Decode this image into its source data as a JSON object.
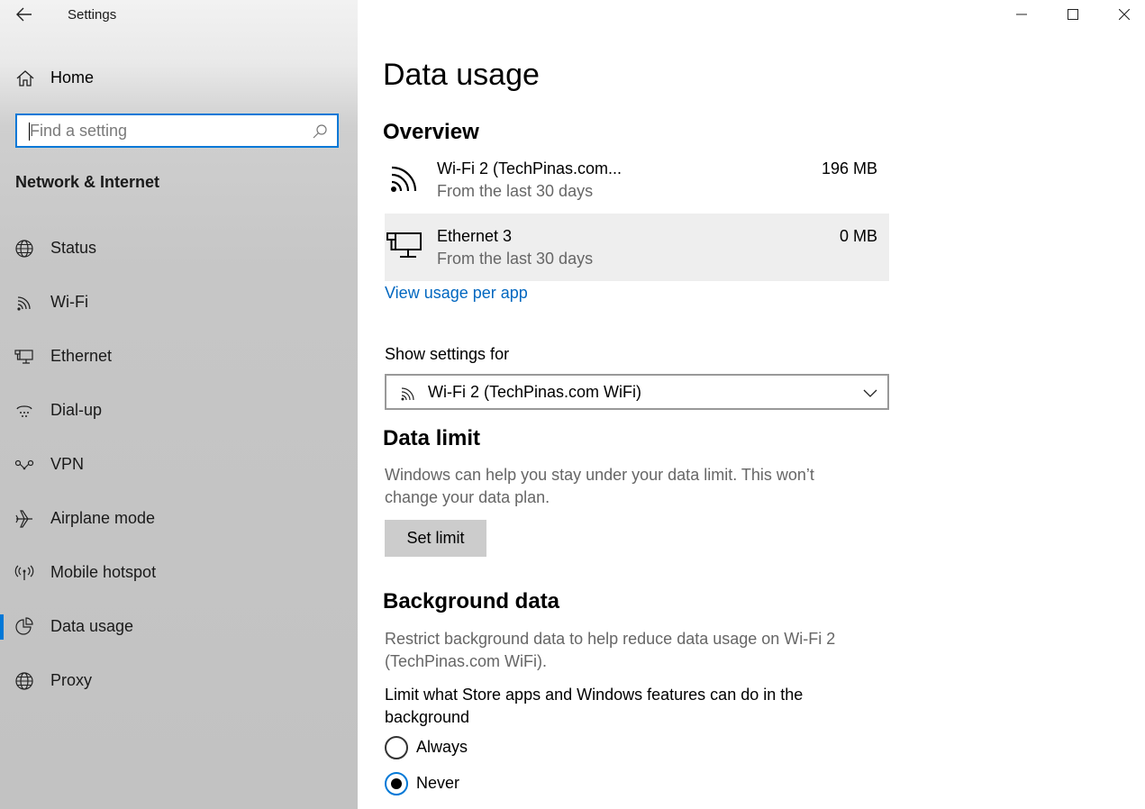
{
  "window": {
    "app_title": "Settings"
  },
  "sidebar": {
    "home_label": "Home",
    "search_placeholder": "Find a setting",
    "section_title": "Network & Internet",
    "items": [
      {
        "label": "Status",
        "icon": "globe-icon"
      },
      {
        "label": "Wi-Fi",
        "icon": "wifi-icon"
      },
      {
        "label": "Ethernet",
        "icon": "ethernet-icon"
      },
      {
        "label": "Dial-up",
        "icon": "dialup-icon"
      },
      {
        "label": "VPN",
        "icon": "vpn-icon"
      },
      {
        "label": "Airplane mode",
        "icon": "airplane-icon"
      },
      {
        "label": "Mobile hotspot",
        "icon": "hotspot-icon"
      },
      {
        "label": "Data usage",
        "icon": "pie-chart-icon",
        "active": true
      },
      {
        "label": "Proxy",
        "icon": "globe-icon"
      }
    ]
  },
  "main": {
    "page_title": "Data usage",
    "overview": {
      "heading": "Overview",
      "rows": [
        {
          "name": "Wi-Fi 2 (TechPinas.com...",
          "sub": "From the last 30 days",
          "amount": "196 MB",
          "icon": "wifi-icon"
        },
        {
          "name": "Ethernet 3",
          "sub": "From the last 30 days",
          "amount": "0 MB",
          "icon": "ethernet-icon"
        }
      ],
      "link": "View usage per app"
    },
    "show_settings": {
      "label": "Show settings for",
      "selected": "Wi-Fi 2 (TechPinas.com WiFi)"
    },
    "data_limit": {
      "heading": "Data limit",
      "desc": "Windows can help you stay under your data limit. This won’t change your data plan.",
      "button": "Set limit"
    },
    "background_data": {
      "heading": "Background data",
      "desc": "Restrict background data to help reduce data usage on Wi-Fi 2 (TechPinas.com WiFi).",
      "question": "Limit what Store apps and Windows features can do in the background",
      "options": [
        {
          "label": "Always",
          "selected": false
        },
        {
          "label": "Never",
          "selected": true
        }
      ]
    }
  },
  "colors": {
    "accent": "#0078d7",
    "link": "#0067c0"
  }
}
